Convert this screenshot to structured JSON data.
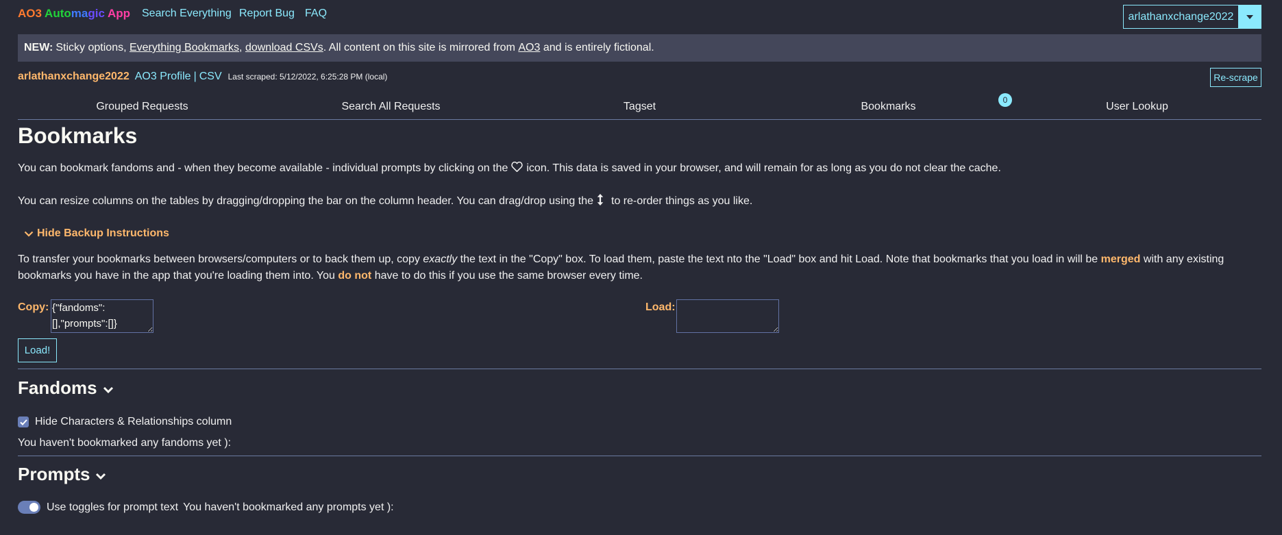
{
  "header": {
    "brand_parts": [
      {
        "text": "AO3 ",
        "color": "#ff7a2f"
      },
      {
        "text": "Auto",
        "color": "#21d33a"
      },
      {
        "text": "ma",
        "color": "#3f7bff"
      },
      {
        "text": "gic ",
        "color": "#6a4cff"
      },
      {
        "text": "App",
        "color": "#ff3ea5"
      }
    ],
    "nav": [
      "Search Everything",
      "Report Bug",
      "FAQ"
    ],
    "user_dropdown": "arlathanxchange2022"
  },
  "banner": {
    "prefix": "NEW:",
    "t1": "Sticky options,",
    "l1": "Everything Bookmarks",
    "t2": ",",
    "l2": "download CSVs",
    "t3": ". All content on this site is mirrored from",
    "l3": "AO3",
    "t4": "and is entirely fictional."
  },
  "scrape": {
    "username": "arlathanxchange2022",
    "profile_link": "AO3 Profile",
    "separator": "|",
    "csv_link": "CSV",
    "last_scraped": "Last scraped: 5/12/2022, 6:25:28 PM (local)",
    "rescrape_button": "Re-scrape"
  },
  "tabs": [
    "Grouped Requests",
    "Search All Requests",
    "Tagset",
    "Bookmarks",
    "User Lookup"
  ],
  "bookmarks_badge": "0",
  "main": {
    "title": "Bookmarks",
    "p1_before": "You can bookmark fandoms and - when they become available - individual prompts by clicking on the",
    "p1_after": "icon. This data is saved in your browser, and will remain for as long as you do not clear the cache.",
    "p2_before": "You can resize columns on the tables by dragging/dropping the bar on the column header. You can drag/drop using the",
    "p2_after": "to re-order things as you like.",
    "backup_toggle": "Hide Backup Instructions",
    "backup": {
      "a": "To transfer your bookmarks between browsers/computers or to back them up, copy",
      "b": "exactly",
      "c": "the text in the \"Copy\" box. To load them, paste the text nto the \"Load\" box and hit Load. Note that bookmarks that you load in will be",
      "d": "merged",
      "e": "with any existing bookmarks you have in the app that you're loading them into. You",
      "f": "do not",
      "g": "have to do this if you use the same browser every time."
    },
    "copy_label": "Copy:",
    "copy_value": "{\"fandoms\":[],\"prompts\":[]}",
    "load_label": "Load:",
    "load_value": "",
    "load_button": "Load!"
  },
  "fandoms": {
    "heading": "Fandoms",
    "checkbox_label": "Hide Characters & Relationships column",
    "checkbox_checked": true,
    "empty": "You haven't bookmarked any fandoms yet ):"
  },
  "prompts": {
    "heading": "Prompts",
    "toggle_label": "Use toggles for prompt text",
    "toggle_on": true,
    "empty": "You haven't bookmarked any prompts yet ):"
  }
}
